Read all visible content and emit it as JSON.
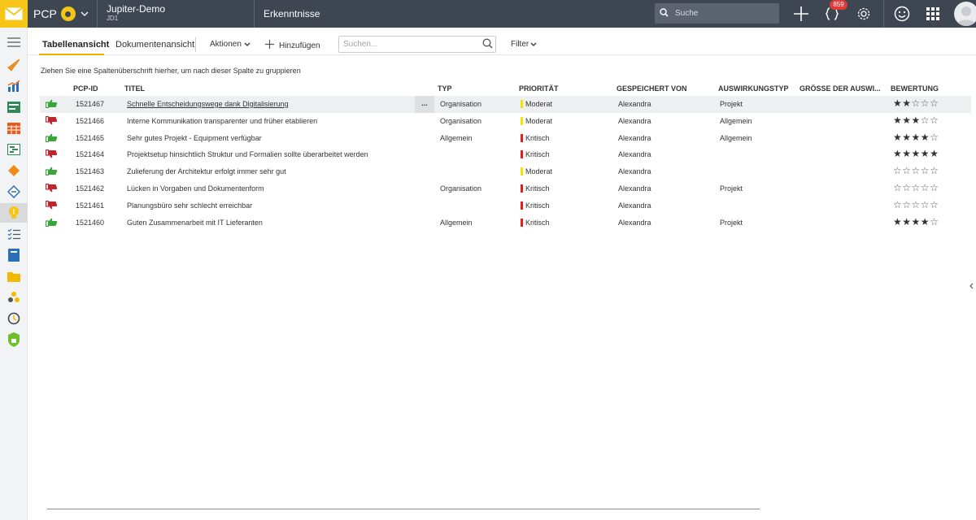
{
  "topbar": {
    "app_name": "PCP",
    "project_name": "Jupiter-Demo",
    "project_code": "JD1",
    "module_title": "Erkenntnisse",
    "search_placeholder": "Suche",
    "notification_count": "859"
  },
  "toolbar": {
    "tab_table": "Tabellenansicht",
    "tab_document": "Dokumentenansicht",
    "actions_label": "Aktionen",
    "add_label": "Hinzufügen",
    "search_placeholder": "Suchen...",
    "filter_label": "Filter"
  },
  "grid": {
    "group_hint": "Ziehen Sie eine Spaltenüberschrift hierher, um nach dieser Spalte zu gruppieren",
    "headers": {
      "id": "PCP-ID",
      "title": "TITEL",
      "type": "TYP",
      "priority": "PRIORITÄT",
      "saved_by": "GESPEICHERT VON",
      "impact_type": "AUSWIRKUNGSTYP",
      "impact_size": "GRÖSSE DER AUSWI...",
      "rating": "BEWERTUNG"
    },
    "more_label": "...",
    "rows": [
      {
        "sentiment": "positive",
        "id": "1521467",
        "title": "Schnelle Entscheidungswege dank Digitalisierung",
        "type": "Organisation",
        "priority": "Moderat",
        "priority_color": "#f2e600",
        "saved_by": "Alexandra",
        "impact_type": "Projekt",
        "impact_size": "",
        "rating": 2
      },
      {
        "sentiment": "negative",
        "id": "1521466",
        "title": "Interne Kommunikation transparenter und früher etablieren",
        "type": "Organisation",
        "priority": "Moderat",
        "priority_color": "#f2e600",
        "saved_by": "Alexandra",
        "impact_type": "Allgemein",
        "impact_size": "",
        "rating": 3
      },
      {
        "sentiment": "positive",
        "id": "1521465",
        "title": "Sehr gutes Projekt - Equipment verfügbar",
        "type": "Allgemein",
        "priority": "Kritisch",
        "priority_color": "#e02020",
        "saved_by": "Alexandra",
        "impact_type": "Allgemein",
        "impact_size": "",
        "rating": 4
      },
      {
        "sentiment": "negative",
        "id": "1521464",
        "title": "Projektsetup hinsichtlich Struktur und Formalien sollte überarbeitet werden",
        "type": "",
        "priority": "Kritisch",
        "priority_color": "#e02020",
        "saved_by": "Alexandra",
        "impact_type": "",
        "impact_size": "",
        "rating": 5
      },
      {
        "sentiment": "positive",
        "id": "1521463",
        "title": "Zulieferung der Architektur erfolgt immer sehr gut",
        "type": "",
        "priority": "Moderat",
        "priority_color": "#f2e600",
        "saved_by": "Alexandra",
        "impact_type": "",
        "impact_size": "",
        "rating": 0
      },
      {
        "sentiment": "negative",
        "id": "1521462",
        "title": "Lücken in Vorgaben und Dokumentenform",
        "type": "Organisation",
        "priority": "Kritisch",
        "priority_color": "#e02020",
        "saved_by": "Alexandra",
        "impact_type": "Projekt",
        "impact_size": "",
        "rating": 0
      },
      {
        "sentiment": "negative",
        "id": "1521461",
        "title": "Planungsbüro sehr schlecht erreichbar",
        "type": "",
        "priority": "Kritisch",
        "priority_color": "#e02020",
        "saved_by": "Alexandra",
        "impact_type": "",
        "impact_size": "",
        "rating": 0
      },
      {
        "sentiment": "positive",
        "id": "1521460",
        "title": "Guten Zusammenarbeit mit IT Lieferanten",
        "type": "Allgemein",
        "priority": "Kritisch",
        "priority_color": "#e02020",
        "saved_by": "Alexandra",
        "impact_type": "Projekt",
        "impact_size": "",
        "rating": 4
      }
    ]
  },
  "colors": {
    "topbar": "#3d4651",
    "accent": "#f5c518",
    "positive": "#3aa53a",
    "negative": "#c0262d"
  },
  "icons": {
    "sidebar": [
      "hamburger-icon",
      "rocket-icon",
      "chart-icon",
      "board-icon",
      "calendar-grid-icon",
      "timeline-icon",
      "diamond-icon",
      "risk-icon",
      "lightbulb-icon",
      "checklist-icon",
      "book-icon",
      "folder-icon",
      "people-icon",
      "history-icon",
      "lock-icon",
      "settings-icon"
    ]
  }
}
